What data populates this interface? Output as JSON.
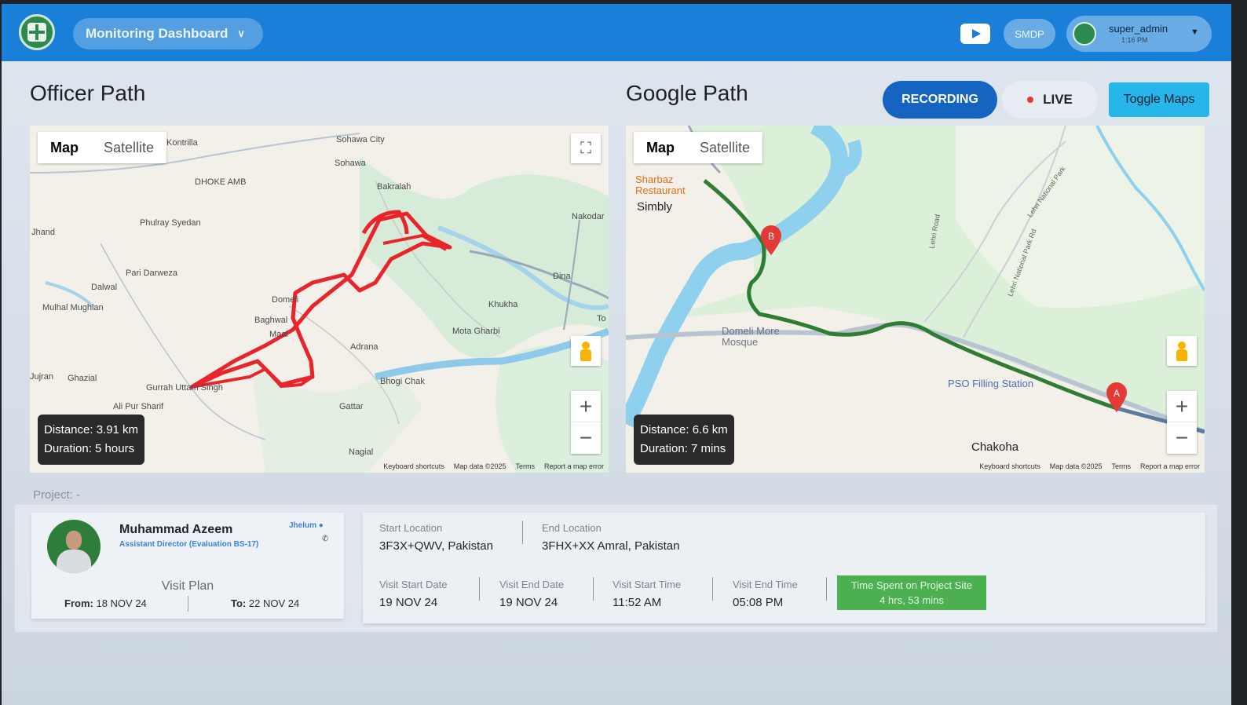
{
  "header": {
    "dashboard_label": "Monitoring Dashboard",
    "smdp_label": "SMDP",
    "user_name": "super_admin",
    "user_time": "1:16 PM"
  },
  "officer_path": {
    "title": "Officer Path",
    "map_tabs": [
      "Map",
      "Satellite"
    ],
    "distance": "Distance: 3.91 km",
    "duration": "Duration: 5 hours",
    "footer": [
      "Keyboard shortcuts",
      "Map data ©2025",
      "Terms",
      "Report a map error"
    ],
    "places": [
      "Sohawa City",
      "Sohawa",
      "Bakralah",
      "Kontrilla",
      "DHOKE AMB",
      "Jhand",
      "Phulray Syedan",
      "Pari Darweza",
      "Dalwal",
      "Mulhal Mughlan",
      "Nakodar",
      "Dina",
      "Khukha",
      "Mota Gharbi",
      "Adrana",
      "Domeli",
      "Baghwal",
      "Maal",
      "Bhogi Chak",
      "Gattar",
      "Ghazial",
      "Gurrah Uttam Singh",
      "Ali Pur Sharif",
      "Jujran",
      "Nagial",
      "To"
    ]
  },
  "google_path": {
    "title": "Google Path",
    "recording_label": "RECORDING",
    "live_label": "LIVE",
    "toggle_label": "Toggle Maps",
    "map_tabs": [
      "Map",
      "Satellite"
    ],
    "distance": "Distance: 6.6 km",
    "duration": "Duration: 7 mins",
    "footer": [
      "Keyboard shortcuts",
      "Map data ©2025",
      "Terms",
      "Report a map error"
    ],
    "places": [
      "Sharbaz Restaurant",
      "Simbly",
      "Domeli More Mosque",
      "PSO Filling Station",
      "Chakoha",
      "Lehri Road",
      "Lehri National Park",
      "Lehri National Park Rd"
    ],
    "markers": [
      "A",
      "B"
    ]
  },
  "project": {
    "label": "Project: -"
  },
  "officer": {
    "name": "Muhammad Azeem",
    "role": "Assistant Director (Evaluation BS-17)",
    "city": "Jhelum",
    "visit_plan_label": "Visit Plan",
    "from_label": "From:",
    "from_value": "18 NOV 24",
    "to_label": "To:",
    "to_value": "22 NOV 24"
  },
  "visit": {
    "start_location_label": "Start Location",
    "start_location_value": "3F3X+QWV, Pakistan",
    "end_location_label": "End Location",
    "end_location_value": "3FHX+XX Amral, Pakistan",
    "visit_start_date_label": "Visit Start Date",
    "visit_start_date_value": "19 NOV 24",
    "visit_end_date_label": "Visit End Date",
    "visit_end_date_value": "19 NOV 24",
    "visit_start_time_label": "Visit Start Time",
    "visit_start_time_value": "11:52 AM",
    "visit_end_time_label": "Visit End Time",
    "visit_end_time_value": "05:08 PM",
    "time_spent_label": "Time Spent on Project Site",
    "time_spent_value": "4 hrs, 53 mins"
  },
  "colors": {
    "header_blue": "#1a7fd8",
    "recording_blue": "#1565c0",
    "toggle_cyan": "#26b6ea",
    "officer_route_red": "#e8252b",
    "google_route_green": "#2e7d32",
    "time_spent_green": "#4caf50"
  }
}
